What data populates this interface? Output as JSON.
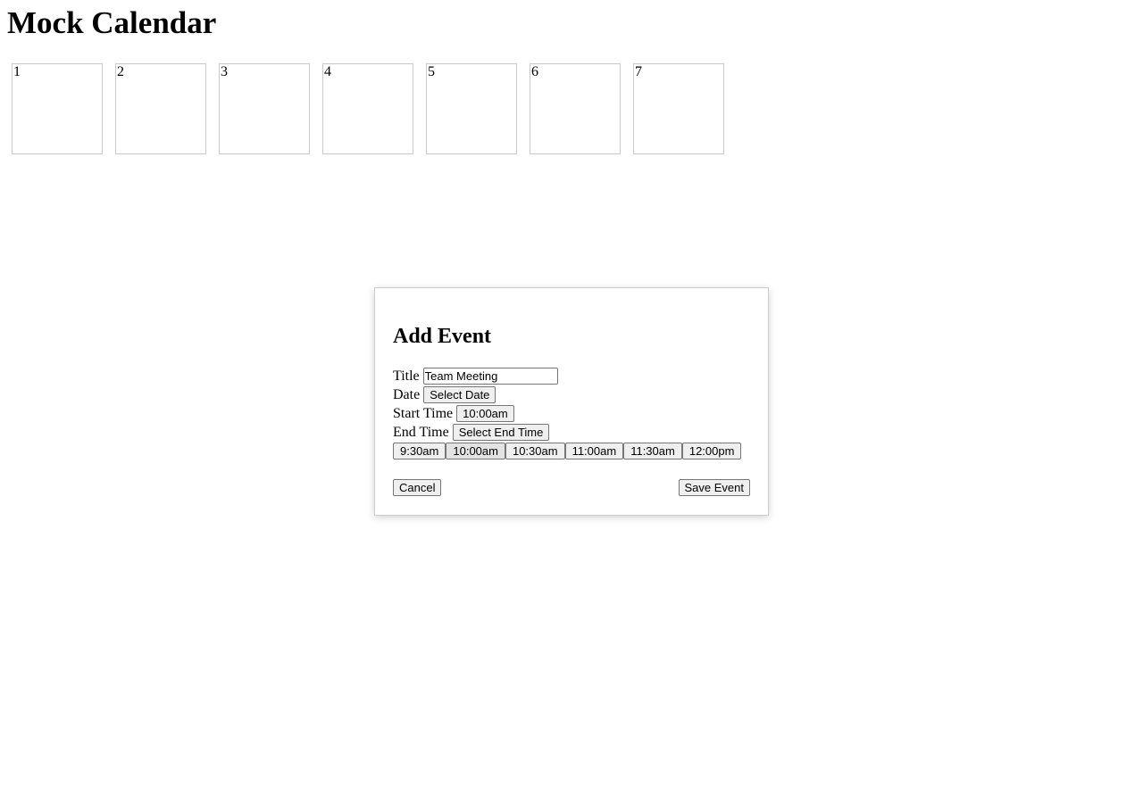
{
  "app": {
    "title": "Mock Calendar"
  },
  "calendar": {
    "days": [
      "1",
      "2",
      "3",
      "4",
      "5",
      "6",
      "7"
    ]
  },
  "modal": {
    "title": "Add Event",
    "title_label": "Title",
    "title_value": "Team Meeting",
    "date_label": "Date",
    "date_button": "Select Date",
    "start_label": "Start Time",
    "start_button": "10:00am",
    "end_label": "End Time",
    "end_button": "Select End Time",
    "time_options": [
      "9:30am",
      "10:00am",
      "10:30am",
      "11:00am",
      "11:30am",
      "12:00pm"
    ],
    "selected_time": "10:00am",
    "cancel_label": "Cancel",
    "save_label": "Save Event"
  }
}
